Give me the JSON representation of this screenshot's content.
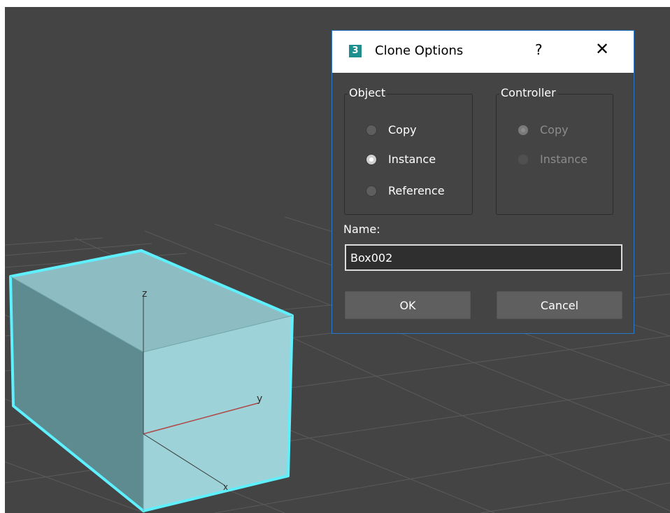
{
  "dialog": {
    "icon_label": "3",
    "title": "Clone Options",
    "help_label": "?",
    "close_label": "✕",
    "object_group": {
      "title": "Object",
      "options": [
        {
          "label": "Copy",
          "checked": false
        },
        {
          "label": "Instance",
          "checked": true
        },
        {
          "label": "Reference",
          "checked": false
        }
      ]
    },
    "controller_group": {
      "title": "Controller",
      "disabled": true,
      "options": [
        {
          "label": "Copy",
          "checked": true
        },
        {
          "label": "Instance",
          "checked": false
        }
      ]
    },
    "name_label": "Name:",
    "name_value": "Box002",
    "ok_label": "OK",
    "cancel_label": "Cancel"
  },
  "viewport": {
    "axis_labels": {
      "z": "z",
      "y": "y",
      "x": "x"
    },
    "colors": {
      "background": "#444444",
      "grid": "#5a5a5a",
      "box_top": "#8dbdc3",
      "box_left": "#5d8b8f",
      "box_right": "#9dd3d8",
      "selection_outline": "#5ff0ff",
      "y_axis": "#b04646"
    }
  }
}
